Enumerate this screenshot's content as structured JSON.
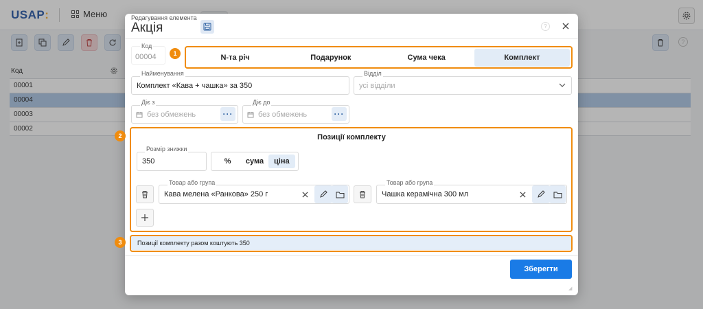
{
  "app": {
    "logo": "USAP",
    "logo_mark": ":",
    "menu_label": "Меню"
  },
  "list": {
    "header_code": "Код",
    "rows": [
      "00001",
      "00004",
      "00003",
      "00002"
    ],
    "selected_index": 1
  },
  "dialog": {
    "subtitle": "Редагування елемента",
    "title": "Акція",
    "code_label": "Код",
    "code_value": "00004",
    "type_tabs": [
      "N-та річ",
      "Подарунок",
      "Сума чека",
      "Комплект"
    ],
    "active_type": "Комплект",
    "name_label": "Найменування",
    "name_value": "Комплект «Кава + чашка» за 350",
    "dept_label": "Відділ",
    "dept_placeholder": "усі відділи",
    "from_label": "Діє з",
    "from_placeholder": "без обмежень",
    "to_label": "Діє до",
    "to_placeholder": "без обмежень",
    "kit_title": "Позиції комплекту",
    "discount_label": "Розмір знижки",
    "discount_value": "350",
    "discount_modes": [
      "%",
      "сума",
      "ціна"
    ],
    "active_mode": "ціна",
    "item_label": "Товар або група",
    "items": [
      {
        "label": "Товар або група",
        "value": "Кава мелена «Ранкова» 250 г"
      },
      {
        "label": "Товар або група",
        "value": "Чашка керамічна 300 мл"
      }
    ],
    "summary": "Позиції комплекту разом коштують 350",
    "save_button": "Зберегти",
    "badges": [
      "1",
      "2",
      "3"
    ]
  },
  "colors": {
    "accent": "#1a7be6",
    "highlight_frame": "#f08c0e",
    "active_tab_bg": "#e2ecf7",
    "summary_bg": "#e4eef9"
  },
  "icons": [
    "grid-icon",
    "gear-icon",
    "save-icon",
    "help-icon",
    "close-icon",
    "calendar-icon",
    "chevron-down-icon",
    "trash-icon",
    "pencil-icon",
    "folder-icon",
    "plus-icon",
    "copy-icon",
    "refresh-icon",
    "add-doc-icon"
  ]
}
